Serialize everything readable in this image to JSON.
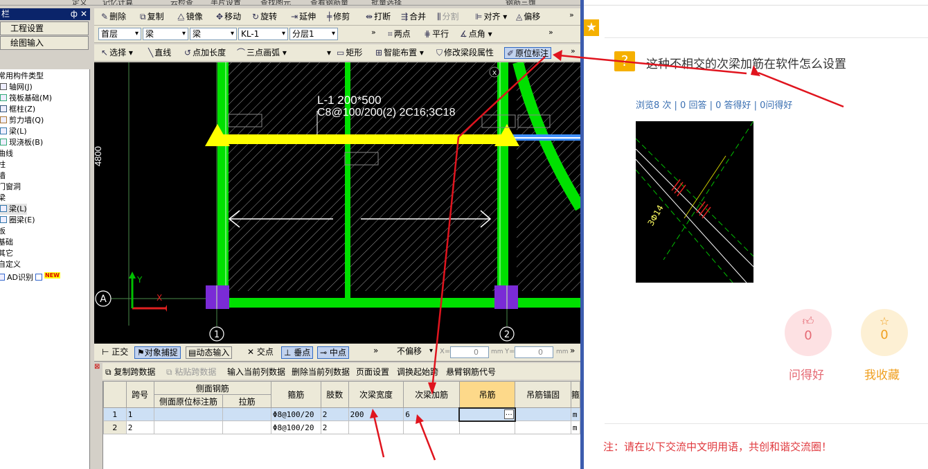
{
  "topstrip": {
    "items": [
      "定义",
      "记忆计算",
      "云检查",
      "半片设置",
      "查找图元",
      "查看钢筋量",
      "批量选择",
      "钢筋三维"
    ]
  },
  "sidebar": {
    "title": "栏",
    "pin": "ф",
    "close": "✕",
    "btn_project": "工程设置",
    "btn_draw": "绘图输入",
    "tree": [
      {
        "label": "常用构件类型",
        "icon": "",
        "indent": 0
      },
      {
        "label": "轴网(J)",
        "icon": "grid-icon",
        "indent": 1
      },
      {
        "label": "筏板基础(M)",
        "icon": "slab-icon",
        "indent": 1
      },
      {
        "label": "框柱(Z)",
        "icon": "column-icon",
        "indent": 1
      },
      {
        "label": "剪力墙(Q)",
        "icon": "wall-icon",
        "indent": 1
      },
      {
        "label": "梁(L)",
        "icon": "beam-icon",
        "indent": 1
      },
      {
        "label": "现浇板(B)",
        "icon": "slab-icon",
        "indent": 1
      },
      {
        "label": "曲线",
        "icon": "",
        "indent": 0
      },
      {
        "label": "柱",
        "icon": "",
        "indent": 0
      },
      {
        "label": "墙",
        "icon": "",
        "indent": 0
      },
      {
        "label": "门窗洞",
        "icon": "",
        "indent": 0
      },
      {
        "label": "梁",
        "icon": "",
        "indent": 0
      },
      {
        "label": "梁(L)",
        "icon": "beam-icon",
        "indent": 1,
        "selected": true
      },
      {
        "label": "圈梁(E)",
        "icon": "ring-beam-icon",
        "indent": 1
      },
      {
        "label": "板",
        "icon": "",
        "indent": 0
      },
      {
        "label": "基础",
        "icon": "",
        "indent": 0
      },
      {
        "label": "其它",
        "icon": "",
        "indent": 0
      },
      {
        "label": "自定义",
        "icon": "",
        "indent": 0
      },
      {
        "label": "AD识别",
        "icon": "cad-icon",
        "indent": 0,
        "new": "NEW"
      }
    ]
  },
  "toolbar1": {
    "delete": "删除",
    "copy": "复制",
    "mirror": "镜像",
    "move": "移动",
    "rotate": "旋转",
    "extend": "延伸",
    "trim": "修剪",
    "break": "打断",
    "merge": "合并",
    "split": "分割",
    "align": "对齐",
    "offset": "偏移",
    "more": "»"
  },
  "toolbar2": {
    "floor": "首层",
    "type1": "梁",
    "type2": "梁",
    "name": "KL-1",
    "layer": "分层1",
    "two_point": "两点",
    "parallel": "平行",
    "point_angle": "点角",
    "more": "»"
  },
  "toolbar3": {
    "select": "选择",
    "line": "直线",
    "point_len": "点加长度",
    "arc": "三点画弧",
    "rect": "矩形",
    "smart": "智能布置",
    "modify": "修改梁段属性",
    "orig": "原位标注",
    "more": "»"
  },
  "canvas": {
    "beam_label": "L-1 200*500",
    "rebar_label": "C8@100/200(2) 2C16;3C18",
    "dim": "4800",
    "axis_a": "A",
    "axis_1": "1",
    "axis_2": "2",
    "axis_y": "Y",
    "axis_x": "X",
    "close": "x"
  },
  "statusbar": {
    "ortho": "正交",
    "snap": "对象捕捉",
    "dynamic": "动态输入",
    "intersect": "交点",
    "perp": "垂点",
    "mid": "中点",
    "offset_mode": "不偏移",
    "x_label": "X=",
    "x_val": "0",
    "y_label": "Y=",
    "y_val": "0",
    "unit": "mm",
    "more": "»"
  },
  "panel": {
    "copy_span": "复制跨数据",
    "paste_span": "粘贴跨数据",
    "input_col": "输入当前列数据",
    "delete_col": "删除当前列数据",
    "page_setup": "页面设置",
    "swap": "调换起始跨",
    "cantilever": "悬臂钢筋代号"
  },
  "grid": {
    "group_header": "侧面钢筋",
    "headers": {
      "span": "跨号",
      "side_orig": "侧面原位标注筋",
      "tie": "拉筋",
      "stirrup": "箍筋",
      "legs": "肢数",
      "sec_width": "次梁宽度",
      "sec_add": "次梁加筋",
      "hanger": "吊筋",
      "hanger_anchor": "吊筋锚固",
      "extra": "箍"
    },
    "rows": [
      {
        "n": "1",
        "span": "1",
        "side": "",
        "tie": "",
        "stirrup": "Φ8@100/20",
        "legs": "2",
        "sec_width": "200",
        "sec_add": "6",
        "hanger": "",
        "anchor": "",
        "extra": "m"
      },
      {
        "n": "2",
        "span": "2",
        "side": "",
        "tie": "",
        "stirrup": "Φ8@100/20",
        "legs": "2",
        "sec_width": "",
        "sec_add": "",
        "hanger": "",
        "anchor": "",
        "extra": "m"
      }
    ]
  },
  "right": {
    "question": "这种不相交的次梁加筋在软件怎么设置",
    "stats": "浏览8 次 | 0 回答 | 0 答得好 | 0问得好",
    "thumb_text": "3Φ14",
    "like_count": "0",
    "like_label": "问得好",
    "fav_count": "0",
    "fav_label": "我收藏",
    "notice": "注：请在以下交流中文明用语，共创和谐交流圈！"
  },
  "colors": {
    "beam_green": "#00e000",
    "yellow": "#ffff00",
    "purple": "#7a2bd6",
    "arrow_red": "#e0141e",
    "accent_blue": "#3a6fb2",
    "gold": "#f5b000"
  }
}
